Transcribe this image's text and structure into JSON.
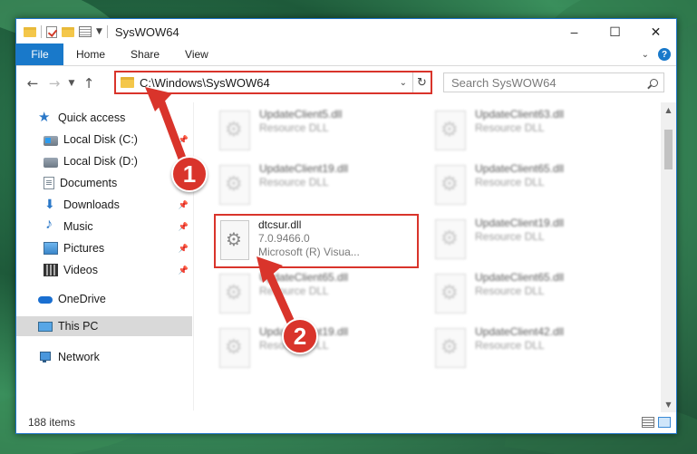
{
  "window": {
    "title": "SysWOW64"
  },
  "ribbon": {
    "tabs": [
      "File",
      "Home",
      "Share",
      "View"
    ]
  },
  "address": {
    "path": "C:\\Windows\\SysWOW64"
  },
  "search": {
    "placeholder": "Search SysWOW64"
  },
  "sidebar": {
    "items": [
      {
        "label": "Quick access"
      },
      {
        "label": "Local Disk (C:)"
      },
      {
        "label": "Local Disk (D:)"
      },
      {
        "label": "Documents"
      },
      {
        "label": "Downloads"
      },
      {
        "label": "Music"
      },
      {
        "label": "Pictures"
      },
      {
        "label": "Videos"
      },
      {
        "label": "OneDrive"
      },
      {
        "label": "This PC"
      },
      {
        "label": "Network"
      }
    ]
  },
  "files": {
    "left": [
      {
        "name": "UpdateClient5.dll",
        "type": "Resource DLL"
      },
      {
        "name": "UpdateClient19.dll",
        "type": "Resource DLL"
      },
      {
        "name": "dtcsur.dll",
        "version": "7.0.9466.0",
        "company": "Microsoft (R) Visua..."
      },
      {
        "name": "UpdateClient65.dll",
        "type": "Resource DLL"
      },
      {
        "name": "UpdateClient19.dll",
        "type": "Resource DLL"
      }
    ],
    "right": [
      {
        "name": "UpdateClient63.dll",
        "type": "Resource DLL"
      },
      {
        "name": "UpdateClient65.dll",
        "type": "Resource DLL"
      },
      {
        "name": "UpdateClient19.dll",
        "type": "Resource DLL"
      },
      {
        "name": "UpdateClient65.dll",
        "type": "Resource DLL"
      },
      {
        "name": "UpdateClient42.dll",
        "type": "Resource DLL"
      }
    ]
  },
  "status": {
    "item_count": "188 items"
  },
  "annotations": {
    "step1": "1",
    "step2": "2",
    "color": "#d9342b"
  }
}
